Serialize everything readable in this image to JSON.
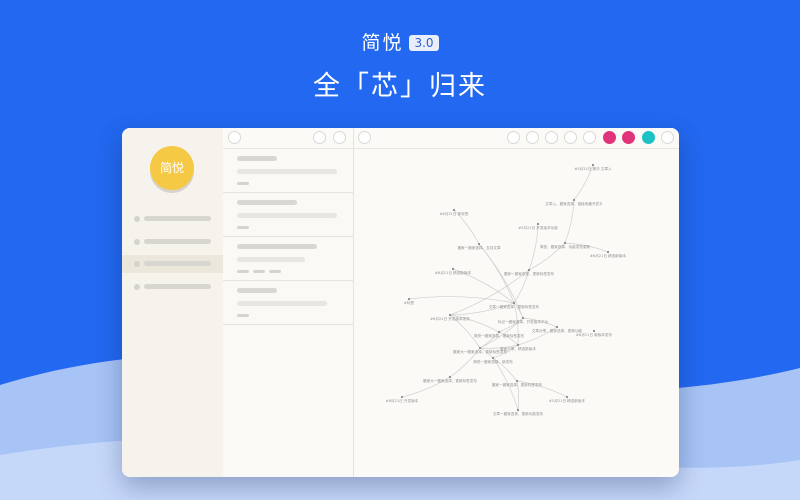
{
  "hero": {
    "app_name": "简悦",
    "version": "3.0",
    "slogan": "全「芯」归来"
  },
  "colors": {
    "background": "#2268f0",
    "wave_light": "#a8c3f6",
    "avatar": "#f6c945",
    "dot_pink": "#e0337a",
    "dot_teal": "#1cc1c6"
  },
  "window": {
    "sidebar": {
      "avatar_label": "简悦",
      "items": [
        {
          "name": "sidebar-item-1",
          "active": false
        },
        {
          "name": "sidebar-item-2",
          "active": false
        },
        {
          "name": "sidebar-item-3",
          "active": true
        },
        {
          "name": "sidebar-item-4",
          "active": false
        }
      ]
    },
    "note_list": {
      "count": 4
    },
    "toolbar": {
      "buttons": [
        "circle-button",
        "circle-button",
        "circle-button",
        "circle-button",
        "circle-button",
        "circle-button"
      ],
      "color_dots": [
        "#e0337a",
        "#e0337a",
        "#1cc1c6"
      ]
    },
    "graph": {
      "nodes": [
        {
          "id": "n1",
          "label": "#5月21日 精华 文章入"
        },
        {
          "id": "n2",
          "label": "文章入、搬家选择、链接收藏开发平"
        },
        {
          "id": "n3",
          "label": "#5月21日 开发版本功能"
        },
        {
          "id": "n4",
          "label": "#6月21日 新标签"
        },
        {
          "id": "n5",
          "label": "简悦、搬家选择、功能发布更新"
        },
        {
          "id": "n6",
          "label": "#6月21日 精选新版本"
        },
        {
          "id": "n7",
          "label": "搬家一搬家选择、支持文章"
        },
        {
          "id": "n8",
          "label": "#6月21日 精选新版本"
        },
        {
          "id": "n9",
          "label": "搬家一搬家选择、更新标签发布"
        },
        {
          "id": "n10",
          "label": "#标签"
        },
        {
          "id": "n11",
          "label": "文章一搬家选择、更新标签发布"
        },
        {
          "id": "n12",
          "label": "标记一搬家选择、开发版本平台"
        },
        {
          "id": "n13",
          "label": "#6月21日 开发版本发布"
        },
        {
          "id": "n14",
          "label": "简悦一搬家选择、更新标签发布"
        },
        {
          "id": "n15",
          "label": "文章分享、搬家选择、更新功能"
        },
        {
          "id": "n16",
          "label": "搬家分享、精选新版本"
        },
        {
          "id": "n17",
          "label": "#6月21日 新版本发布"
        },
        {
          "id": "n18",
          "label": "搬家大一搬家选择、更新标签发布"
        },
        {
          "id": "n19",
          "label": "简悦一搬家选择、新发布"
        },
        {
          "id": "n20",
          "label": "搬家一搬家选择、更新标签发布"
        },
        {
          "id": "n21",
          "label": "搬家大一搬家选择、更新标签发布"
        },
        {
          "id": "n22",
          "label": "#6月21日 开发版本"
        },
        {
          "id": "n23",
          "label": "#5月21日 精选新版本"
        },
        {
          "id": "n24",
          "label": "文章一搬家选择、更新功能发布"
        }
      ],
      "edges": [
        [
          "n1",
          "n2"
        ],
        [
          "n2",
          "n5"
        ],
        [
          "n5",
          "n6"
        ],
        [
          "n5",
          "n9"
        ],
        [
          "n4",
          "n7"
        ],
        [
          "n3",
          "n9"
        ],
        [
          "n7",
          "n11"
        ],
        [
          "n9",
          "n11"
        ],
        [
          "n8",
          "n11"
        ],
        [
          "n10",
          "n11"
        ],
        [
          "n11",
          "n12"
        ],
        [
          "n11",
          "n13"
        ],
        [
          "n12",
          "n14"
        ],
        [
          "n12",
          "n15"
        ],
        [
          "n13",
          "n14"
        ],
        [
          "n14",
          "n16"
        ],
        [
          "n15",
          "n16"
        ],
        [
          "n13",
          "n18"
        ],
        [
          "n14",
          "n18"
        ],
        [
          "n16",
          "n18"
        ],
        [
          "n16",
          "n19"
        ],
        [
          "n18",
          "n19"
        ],
        [
          "n19",
          "n20"
        ],
        [
          "n20",
          "n23"
        ],
        [
          "n18",
          "n21"
        ],
        [
          "n21",
          "n22"
        ],
        [
          "n19",
          "n24"
        ],
        [
          "n20",
          "n24"
        ],
        [
          "n12",
          "n18"
        ],
        [
          "n11",
          "n16"
        ],
        [
          "n7",
          "n12"
        ],
        [
          "n9",
          "n13"
        ]
      ]
    }
  }
}
